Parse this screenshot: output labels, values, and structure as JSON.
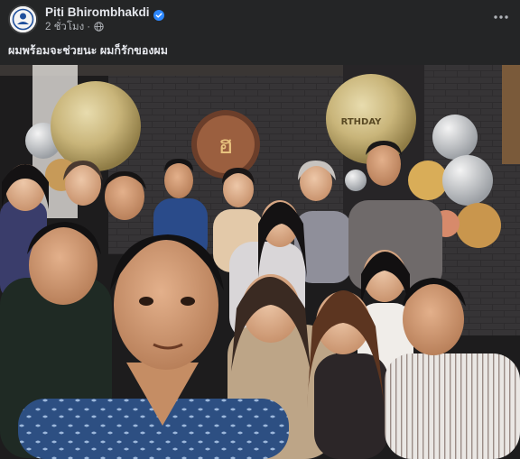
{
  "post": {
    "author": {
      "name": "Piti Bhirombhakdi",
      "verified": true,
      "avatar": "avatar-image"
    },
    "meta": {
      "time": "2 ชั่วโมง",
      "separator": "·",
      "privacy_icon": "globe-icon"
    },
    "caption": "ผมพร้อมจะช่วยนะ ผมก็รักของผม",
    "more_icon": "more-horizontal-icon",
    "photo": {
      "description": "group-selfie-photo",
      "balloon_text": "RTHDAY"
    }
  },
  "colors": {
    "background": "#242526",
    "text_primary": "#e4e6eb",
    "text_secondary": "#b0b3b8",
    "verified_blue": "#2d88ff"
  }
}
